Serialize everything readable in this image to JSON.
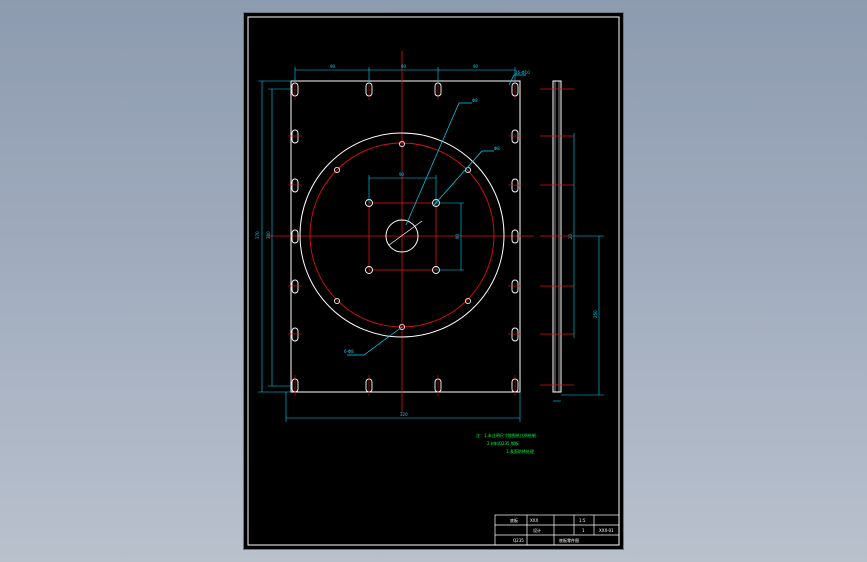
{
  "colors": {
    "background": "#000000",
    "outline": "#ffffff",
    "centerline": "#e01010",
    "dimension": "#00d8ff",
    "note": "#00ff40",
    "accent_slot": "#ffffff"
  },
  "drawing": {
    "dimensions": {
      "top_left": "90",
      "top_mid": "90",
      "top_right": "90",
      "overall_width": "320",
      "overall_height_outer": "370",
      "overall_height_inner": "340",
      "square_top": "90",
      "square_right": "90",
      "side_height": "250",
      "side_mid": "20"
    },
    "callouts": {
      "slot_label": "16-Φ10",
      "hole_top": "Φ8",
      "hole_center": "Φ8",
      "hole_bottom": "6-Φ8"
    },
    "notes": [
      "注：1.未注明尺寸按图纸比例绘制.",
      "2.材料Q235 钢板",
      "3.表面防锈处理"
    ]
  },
  "title_block": {
    "name": "底板",
    "company": "XXX",
    "scale": "1:5",
    "sheet": "1",
    "drawing_no": "XXX-01",
    "material": "Q235",
    "designer": "设计",
    "title": "底板零件图"
  }
}
